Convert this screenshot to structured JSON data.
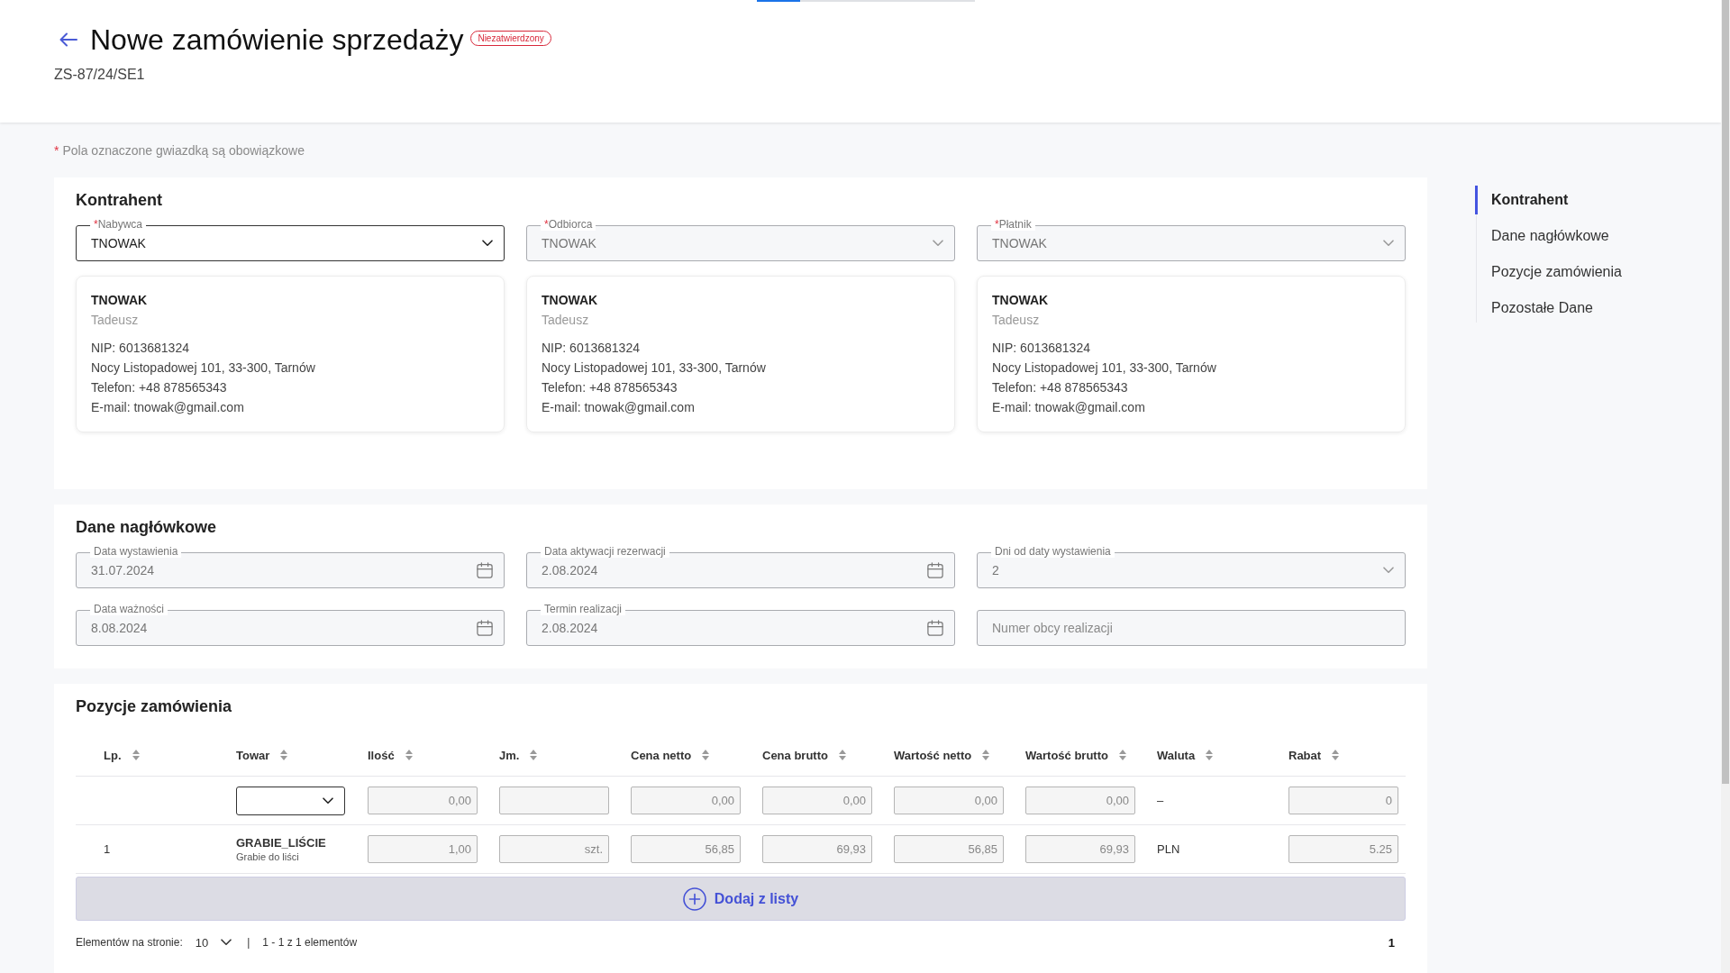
{
  "progress": {
    "level": 0.2
  },
  "header": {
    "title": "Nowe zamówienie sprzedaży",
    "badge": "Niezatwierdzony",
    "number": "ZS-87/24/SE1"
  },
  "required_note": {
    "mark": "*",
    "text": "Pola oznaczone gwiazdką są obowiązkowe"
  },
  "sections": [
    {
      "kind": "parties",
      "title": "Kontrahent",
      "fields": [
        {
          "kind": "select",
          "required_mark": "*",
          "label": "Nabywca",
          "value": "TNOWAK",
          "disabled": false
        },
        {
          "kind": "select",
          "required_mark": "*",
          "label": "Odbiorca",
          "value": "TNOWAK",
          "disabled": true
        },
        {
          "kind": "select",
          "required_mark": "*",
          "label": "Płatnik",
          "value": "TNOWAK",
          "disabled": true
        }
      ],
      "cards": [
        {
          "name": "TNOWAK",
          "person": "Tadeusz",
          "details": [
            "NIP: 6013681324",
            "Nocy Listopadowej 101, 33-300, Tarnów",
            "Telefon: +48 878565343",
            "E-mail: tnowak@gmail.com"
          ]
        },
        {
          "name": "TNOWAK",
          "person": "Tadeusz",
          "details": [
            "NIP: 6013681324",
            "Nocy Listopadowej 101, 33-300, Tarnów",
            "Telefon: +48 878565343",
            "E-mail: tnowak@gmail.com"
          ]
        },
        {
          "name": "TNOWAK",
          "person": "Tadeusz",
          "details": [
            "NIP: 6013681324",
            "Nocy Listopadowej 101, 33-300, Tarnów",
            "Telefon: +48 878565343",
            "E-mail: tnowak@gmail.com"
          ]
        }
      ]
    },
    {
      "kind": "form",
      "title": "Dane nagłówkowe",
      "fields": [
        {
          "kind": "date",
          "label": "Data wystawienia",
          "value": "31.07.2024",
          "disabled": true
        },
        {
          "kind": "date",
          "label": "Data aktywacji rezerwacji",
          "value": "2.08.2024",
          "disabled": true
        },
        {
          "kind": "select",
          "label": "Dni od daty wystawienia",
          "value": "2",
          "disabled": true
        },
        {
          "kind": "date",
          "label": "Data ważności",
          "value": "8.08.2024",
          "disabled": true
        },
        {
          "kind": "date",
          "label": "Termin realizacji",
          "value": "2.08.2024",
          "disabled": true
        },
        {
          "kind": "text",
          "placeholder": "Numer obcy realizacji",
          "disabled": true
        }
      ]
    },
    {
      "kind": "table",
      "title": "Pozycje zamówienia",
      "columns": [
        "Lp.",
        "Towar",
        "Ilość",
        "Jm.",
        "Cena netto",
        "Cena brutto",
        "Wartość netto",
        "Wartość brutto",
        "Waluta",
        "Rabat"
      ],
      "rows": [
        {
          "cells": [
            {
              "kind": "empty"
            },
            {
              "kind": "select",
              "disabled": false
            },
            {
              "kind": "input",
              "value": "0,00",
              "disabled": true
            },
            {
              "kind": "input",
              "disabled": true
            },
            {
              "kind": "input",
              "value": "0,00",
              "disabled": true
            },
            {
              "kind": "input",
              "value": "0,00",
              "disabled": true
            },
            {
              "kind": "input",
              "value": "0,00",
              "disabled": true
            },
            {
              "kind": "input",
              "value": "0,00",
              "disabled": true
            },
            {
              "kind": "text",
              "value": "–"
            },
            {
              "kind": "input",
              "value": "0",
              "disabled": true
            }
          ]
        },
        {
          "cells": [
            {
              "kind": "text",
              "value": "1"
            },
            {
              "kind": "product",
              "name": "GRABIE_LIŚCIE",
              "description": "Grabie do liści"
            },
            {
              "kind": "input",
              "value": "1,00",
              "disabled": true
            },
            {
              "kind": "input",
              "value": "szt.",
              "disabled": true
            },
            {
              "kind": "input",
              "value": "56,85",
              "disabled": true
            },
            {
              "kind": "input",
              "value": "69,93",
              "disabled": true
            },
            {
              "kind": "input",
              "value": "56,85",
              "disabled": true
            },
            {
              "kind": "input",
              "value": "69,93",
              "disabled": true
            },
            {
              "kind": "text",
              "value": "PLN"
            },
            {
              "kind": "input",
              "value": "5.25",
              "disabled": true
            }
          ]
        }
      ],
      "add_button": "Dodaj z listy",
      "pagination": {
        "page_size_label": "Elementów na stronie:",
        "page_size": "10",
        "separator": "|",
        "range": "1 - 1 z 1 elementów",
        "pages": [
          {
            "label": "1",
            "selected": true
          }
        ]
      }
    }
  ],
  "nav": {
    "items": [
      {
        "label": "Kontrahent",
        "selected": true
      },
      {
        "label": "Dane nagłówkowe",
        "selected": false
      },
      {
        "label": "Pozycje zamówienia",
        "selected": false
      },
      {
        "label": "Pozostałe Dane",
        "selected": false
      }
    ]
  }
}
